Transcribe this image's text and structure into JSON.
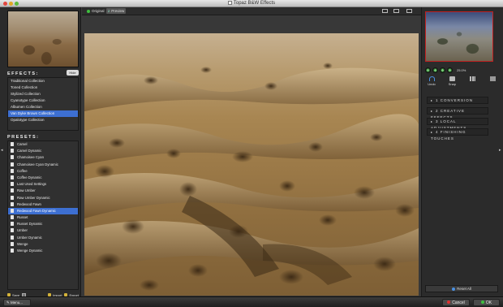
{
  "window": {
    "title": "Topaz B&W Effects"
  },
  "left": {
    "hide_label": "Hide",
    "effects_header": "EFFECTS:",
    "effects": [
      {
        "label": "Traditional Collection"
      },
      {
        "label": "Toned Collection"
      },
      {
        "label": "Stylized Collection"
      },
      {
        "label": "Cyanotype Collection"
      },
      {
        "label": "Albumen Collection"
      },
      {
        "label": "Van Dyke Brown Collection",
        "selected": true
      },
      {
        "label": "Opalotype Collection"
      }
    ],
    "presets_header": "PRESETS:",
    "presets": [
      {
        "label": "Camel"
      },
      {
        "label": "Camel Dynamic"
      },
      {
        "label": "Chamoisee Cyan"
      },
      {
        "label": "Chamoisee Cyan Dynamic"
      },
      {
        "label": "Coffee"
      },
      {
        "label": "Coffee Dynamic"
      },
      {
        "label": "Last Used Settings"
      },
      {
        "label": "Raw Umber"
      },
      {
        "label": "Raw Umber Dynamic"
      },
      {
        "label": "Redwood Fawn"
      },
      {
        "label": "Redwood Fawn Dynamic",
        "selected": true
      },
      {
        "label": "Russet"
      },
      {
        "label": "Russet Dynamic"
      },
      {
        "label": "Umber"
      },
      {
        "label": "Umber Dynamic"
      },
      {
        "label": "Wenge"
      },
      {
        "label": "Wenge Dynamic"
      }
    ],
    "save_label": "Save",
    "import_label": "Import",
    "export_label": "Export"
  },
  "center": {
    "tab_original": "Original",
    "tab_preview_num": "2",
    "tab_preview": "Preview"
  },
  "right": {
    "zoom_value": "25.0%",
    "undo_label": "Undo",
    "snap_label": "Snap",
    "sections": [
      {
        "label": "1 CONVERSION"
      },
      {
        "label": "2 CREATIVE EFFECTS"
      },
      {
        "label": "3 LOCAL ADJUSTMENTS"
      },
      {
        "label": "4 FINISHING TOUCHES"
      }
    ],
    "reset_label": "Reset All"
  },
  "bottom": {
    "menu_label": "Menu...",
    "cancel_label": "Cancel",
    "ok_label": "OK"
  },
  "colors": {
    "selection": "#3d6fd1",
    "panel": "#2b2b2b",
    "accent_green": "#3fbf3f",
    "accent_red": "#e03030"
  }
}
